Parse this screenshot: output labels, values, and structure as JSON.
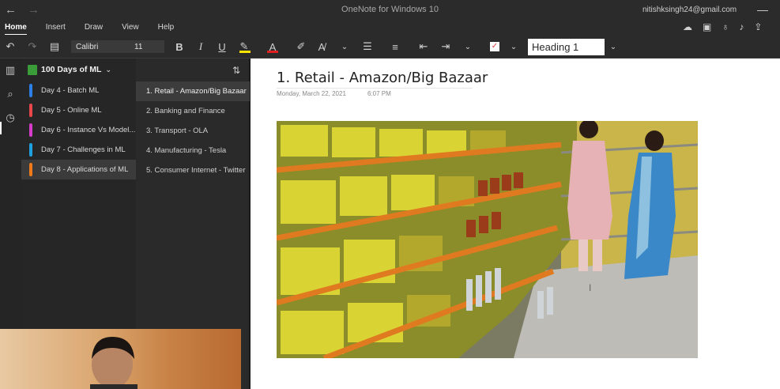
{
  "app": {
    "window_title": "OneNote for Windows 10",
    "user_email": "nitishksingh24@gmail.com"
  },
  "ribbon": {
    "tabs": [
      {
        "label": "Home",
        "active": true
      },
      {
        "label": "Insert",
        "active": false
      },
      {
        "label": "Draw",
        "active": false
      },
      {
        "label": "View",
        "active": false
      },
      {
        "label": "Help",
        "active": false
      }
    ]
  },
  "toolbar": {
    "font_name": "Calibri",
    "font_size": "11",
    "style": "Heading 1",
    "highlight_color": "#ffe600",
    "font_color": "#e02020"
  },
  "notebook": {
    "name": "100 Days of ML",
    "sections": [
      {
        "label": "Day 4 - Batch ML",
        "color": "#2b7fe6",
        "active": false
      },
      {
        "label": "Day 5 - Online ML",
        "color": "#e8474b",
        "active": false
      },
      {
        "label": "Day 6 - Instance Vs Model...",
        "color": "#d63cc9",
        "active": false
      },
      {
        "label": "Day 7 - Challenges in ML",
        "color": "#1fa0e0",
        "active": false
      },
      {
        "label": "Day 8 - Applications of ML",
        "color": "#f07a1a",
        "active": true
      }
    ],
    "pages": [
      {
        "label": "1. Retail - Amazon/Big Bazaar",
        "active": true
      },
      {
        "label": "2. Banking and Finance",
        "active": false
      },
      {
        "label": "3. Transport - OLA",
        "active": false
      },
      {
        "label": "4. Manufacturing - Tesla",
        "active": false
      },
      {
        "label": "5. Consumer Internet - Twitter",
        "active": false
      }
    ]
  },
  "page": {
    "title": "1. Retail - Amazon/Big Bazaar",
    "date": "Monday, March 22, 2021",
    "time": "6:07 PM"
  }
}
